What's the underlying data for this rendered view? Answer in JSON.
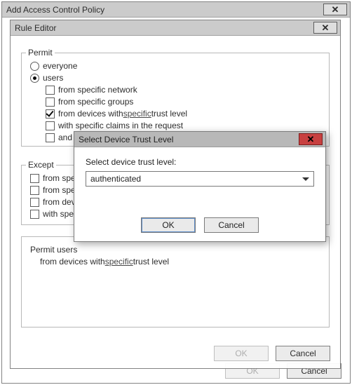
{
  "outer": {
    "title": "Add Access Control Policy",
    "ok": "OK",
    "cancel": "Cancel"
  },
  "rule": {
    "title": "Rule Editor",
    "ok": "OK",
    "cancel": "Cancel",
    "permit": {
      "legend": "Permit",
      "everyone": "everyone",
      "users": "users",
      "opt1": "from specific network",
      "opt2": "from specific groups",
      "opt3_pre": "from devices with ",
      "opt3_link": "specific",
      "opt3_post": " trust level",
      "opt4": "with specific claims in the request",
      "opt5": "and require multi-factor authentication"
    },
    "except": {
      "legend": "Except",
      "opt1": "from specific network",
      "opt2": "from specific groups",
      "opt3": "from devices with specific trust level",
      "opt4": "with specific claims in the request"
    },
    "summary": {
      "line1": "Permit users",
      "line2_pre": "from devices with ",
      "line2_link": "specific",
      "line2_post": " trust level"
    }
  },
  "modal": {
    "title": "Select Device Trust Level",
    "label": "Select device trust level:",
    "value": "authenticated",
    "ok": "OK",
    "cancel": "Cancel"
  }
}
